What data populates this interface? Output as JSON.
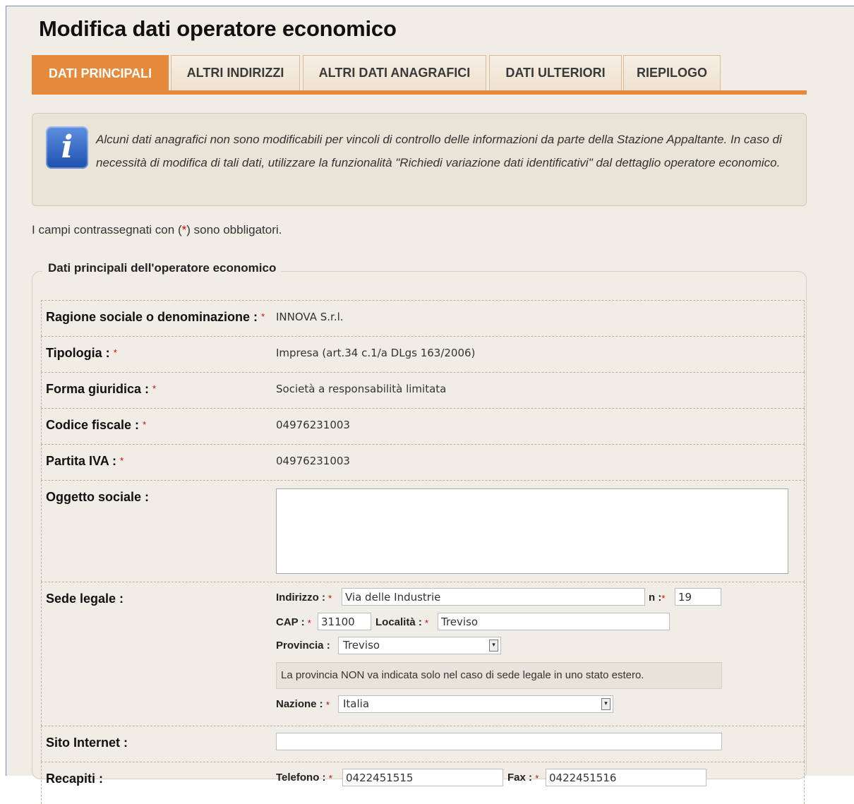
{
  "page": {
    "title": "Modifica dati operatore economico"
  },
  "tabs": [
    {
      "label": "DATI PRINCIPALI",
      "active": true
    },
    {
      "label": "ALTRI INDIRIZZI"
    },
    {
      "label": "ALTRI DATI ANAGRAFICI"
    },
    {
      "label": "DATI ULTERIORI"
    },
    {
      "label": "RIEPILOGO"
    }
  ],
  "info": {
    "icon": "info-icon",
    "text": "Alcuni dati anagrafici non sono modificabili per vincoli di controllo delle informazioni da parte della Stazione Appaltante. In caso di necessità di modifica di tali dati, utilizzare la funzionalità \"Richiedi variazione dati identificativi\" dal dettaglio operatore economico."
  },
  "required_note": {
    "before": "I campi contrassegnati con (",
    "star": "*",
    "after": ") sono obbligatori."
  },
  "fieldset": {
    "legend": "Dati principali dell'operatore economico"
  },
  "required_mark": "*",
  "fields": {
    "ragione_sociale": {
      "label": "Ragione sociale o denominazione :",
      "value": "INNOVA S.r.l."
    },
    "tipologia": {
      "label": "Tipologia :",
      "value": "Impresa (art.34 c.1/a DLgs 163/2006)"
    },
    "forma_giuridica": {
      "label": "Forma giuridica :",
      "value": "Società a responsabilità limitata"
    },
    "codice_fiscale": {
      "label": "Codice fiscale :",
      "value": "04976231003"
    },
    "partita_iva": {
      "label": "Partita IVA :",
      "value": "04976231003"
    },
    "oggetto_sociale": {
      "label": "Oggetto sociale :",
      "value": ""
    },
    "sede_legale": {
      "label": "Sede legale :",
      "indirizzo_label": "Indirizzo :",
      "indirizzo": "Via delle Industrie",
      "n_label": "n :",
      "n": "19",
      "cap_label": "CAP :",
      "cap": "31100",
      "localita_label": "Località :",
      "localita": "Treviso",
      "provincia_label": "Provincia :",
      "provincia": "Treviso",
      "hint": "La provincia NON va indicata solo nel caso di sede legale in uno stato estero.",
      "nazione_label": "Nazione :",
      "nazione": "Italia"
    },
    "sito_internet": {
      "label": "Sito Internet :",
      "value": ""
    },
    "recapiti": {
      "label": "Recapiti :",
      "telefono_label": "Telefono :",
      "telefono": "0422451515",
      "fax_label": "Fax :",
      "fax": "0422451516"
    }
  }
}
